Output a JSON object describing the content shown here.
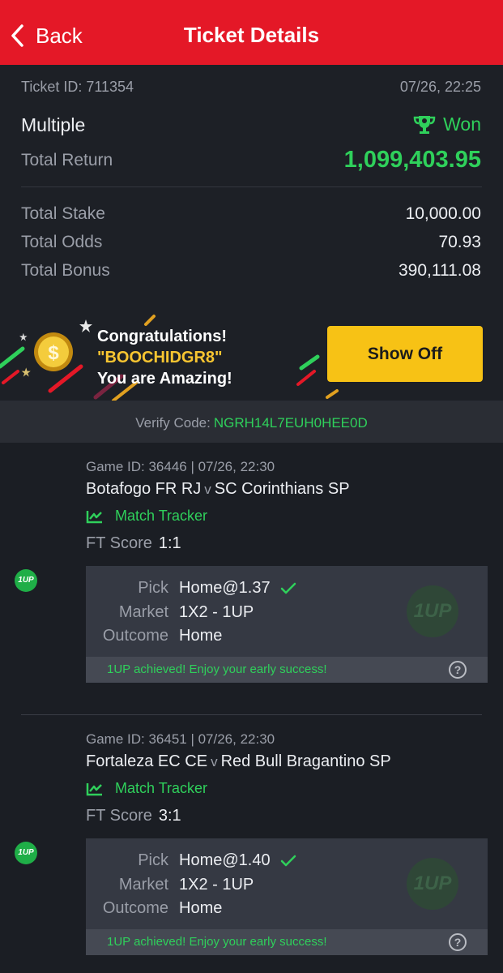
{
  "header": {
    "back_label": "Back",
    "title": "Ticket Details"
  },
  "ticket": {
    "id_text": "Ticket ID: 711354",
    "datetime": "07/26, 22:25",
    "type": "Multiple",
    "status": "Won",
    "total_return_label": "Total Return",
    "total_return": "1,099,403.95",
    "stake_label": "Total Stake",
    "stake": "10,000.00",
    "odds_label": "Total Odds",
    "odds": "70.93",
    "bonus_label": "Total Bonus",
    "bonus": "390,111.08"
  },
  "congrats": {
    "line1": "Congratulations!",
    "username": "\"BOOCHIDGR8\"",
    "line3": "You are Amazing!",
    "button": "Show Off"
  },
  "verify": {
    "label": "Verify Code:",
    "code": "NGRH14L7EUH0HEE0D"
  },
  "bets": [
    {
      "game_id": "Game ID: 36446 | 07/26, 22:30",
      "home": "Botafogo FR RJ",
      "vs": "v",
      "away": "SC Corinthians SP",
      "tracker": "Match Tracker",
      "ft_label": "FT Score",
      "ft_score": "1:1",
      "badge": "1UP",
      "pick_label": "Pick",
      "pick": "Home@1.37",
      "market_label": "Market",
      "market": "1X2 - 1UP",
      "outcome_label": "Outcome",
      "outcome": "Home",
      "footer": "1UP achieved! Enjoy your early success!",
      "help": "?"
    },
    {
      "game_id": "Game ID: 36451 | 07/26, 22:30",
      "home": "Fortaleza EC CE",
      "vs": "v",
      "away": "Red Bull Bragantino SP",
      "tracker": "Match Tracker",
      "ft_label": "FT Score",
      "ft_score": "3:1",
      "badge": "1UP",
      "pick_label": "Pick",
      "pick": "Home@1.40",
      "market_label": "Market",
      "market": "1X2 - 1UP",
      "outcome_label": "Outcome",
      "outcome": "Home",
      "footer": "1UP achieved! Enjoy your early success!",
      "help": "?"
    }
  ],
  "colors": {
    "header": "#e41827",
    "won_green": "#2fd05b",
    "showoff_yellow": "#f7c215",
    "background": "#1b1e24"
  }
}
